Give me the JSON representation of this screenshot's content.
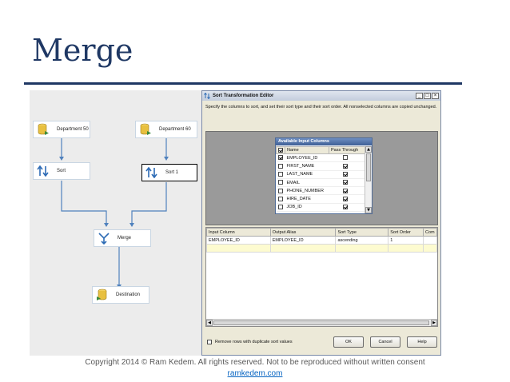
{
  "slide": {
    "title": "Merge",
    "footer": "Copyright 2014 © Ram Kedem. All rights reserved. Not to be reproduced without written consent",
    "link": "ramkedem.com"
  },
  "flow": {
    "department_50": "Department 50",
    "department_60": "Department 60",
    "sort": "Sort",
    "sort_1": "Sort 1",
    "merge": "Merge",
    "destination": "Destination"
  },
  "editor": {
    "title": "Sort Transformation Editor",
    "description": "Specify the columns to sort, and set their sort type and their sort order. All nonselected columns are copied unchanged.",
    "available": {
      "header": "Available Input Columns",
      "col_name": "Name",
      "col_pass": "Pass Through",
      "rows": [
        {
          "name": "EMPLOYEE_ID",
          "checked": true,
          "pass": false
        },
        {
          "name": "FIRST_NAME",
          "checked": false,
          "pass": true
        },
        {
          "name": "LAST_NAME",
          "checked": false,
          "pass": true
        },
        {
          "name": "EMAIL",
          "checked": false,
          "pass": true
        },
        {
          "name": "PHONE_NUMBER",
          "checked": false,
          "pass": true
        },
        {
          "name": "HIRE_DATE",
          "checked": false,
          "pass": true
        },
        {
          "name": "JOB_ID",
          "checked": false,
          "pass": true
        }
      ]
    },
    "grid": {
      "columns": [
        "Input Column",
        "Output Alias",
        "Sort Type",
        "Sort Order",
        "Com"
      ],
      "row": [
        "EMPLOYEE_ID",
        "EMPLOYEE_ID",
        "ascending",
        "1",
        ""
      ]
    },
    "remove_duplicates": "Remove rows with duplicate sort values",
    "ok": "OK",
    "cancel": "Cancel",
    "help": "Help"
  },
  "colors": {
    "title": "#1f3864",
    "link": "#0563c1",
    "connector": "#4f81bd",
    "selected_row": "#fdfbd0"
  },
  "icons": [
    "source-db-icon",
    "sort-icon",
    "merge-icon",
    "destination-db-icon",
    "sort-editor-icon"
  ]
}
